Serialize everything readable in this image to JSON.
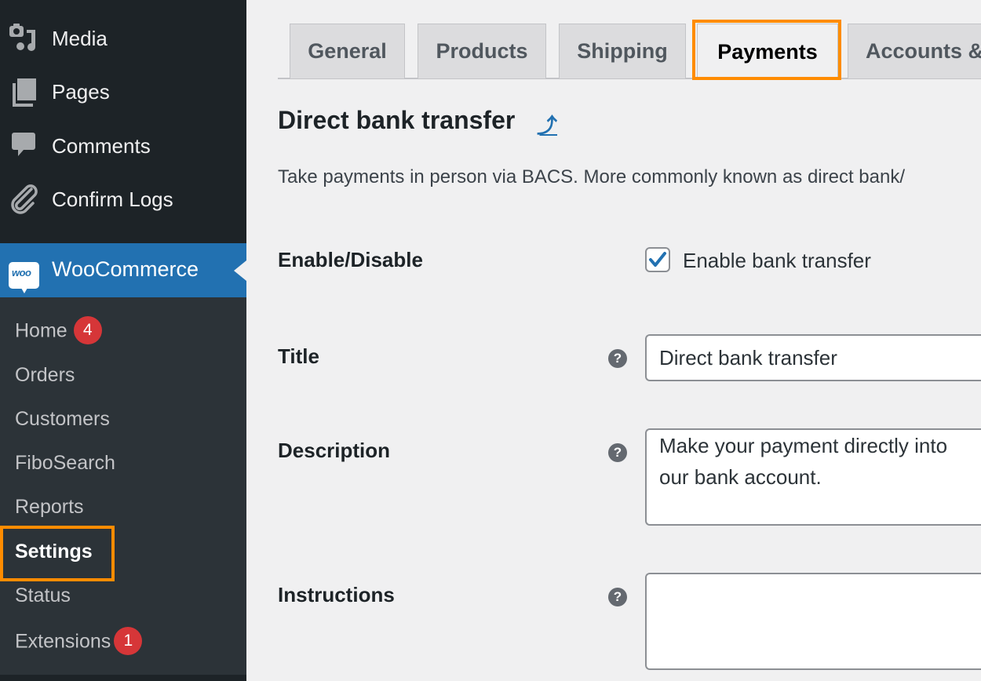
{
  "sidebar": {
    "top_items": [
      {
        "label": "Media",
        "icon": "media-icon"
      },
      {
        "label": "Pages",
        "icon": "pages-icon"
      },
      {
        "label": "Comments",
        "icon": "comments-icon"
      },
      {
        "label": "Confirm Logs",
        "icon": "paperclip-icon"
      }
    ],
    "woocommerce": {
      "label": "WooCommerce",
      "logo_text": "woo"
    },
    "submenu": [
      {
        "label": "Home",
        "badge": "4"
      },
      {
        "label": "Orders"
      },
      {
        "label": "Customers"
      },
      {
        "label": "FiboSearch"
      },
      {
        "label": "Reports"
      },
      {
        "label": "Settings",
        "current": true
      },
      {
        "label": "Status"
      },
      {
        "label": "Extensions",
        "badge": "1"
      }
    ]
  },
  "tabs": [
    {
      "label": "General"
    },
    {
      "label": "Products"
    },
    {
      "label": "Shipping"
    },
    {
      "label": "Payments",
      "active": true
    },
    {
      "label": "Accounts &"
    }
  ],
  "section": {
    "title": "Direct bank transfer",
    "up_link": "⤴",
    "description": "Take payments in person via BACS. More commonly known as direct bank/"
  },
  "fields": {
    "enable": {
      "label": "Enable/Disable",
      "checkbox_label": "Enable bank transfer",
      "checked": true
    },
    "title": {
      "label": "Title",
      "value": "Direct bank transfer"
    },
    "description": {
      "label": "Description",
      "value": "Make your payment directly into our bank account."
    },
    "instructions": {
      "label": "Instructions",
      "value": ""
    }
  },
  "colors": {
    "highlight": "#ff8c00",
    "accent": "#2271b1",
    "badge": "#d63638"
  }
}
